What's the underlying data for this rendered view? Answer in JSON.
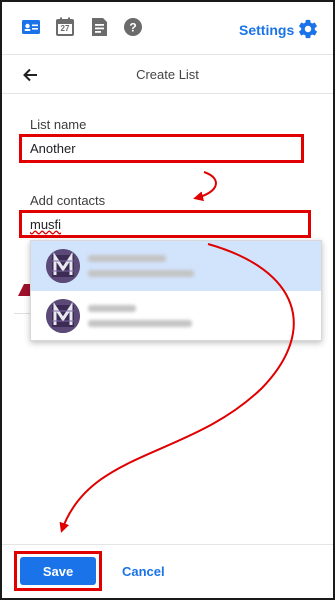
{
  "topbar": {
    "icons": [
      "contacts-icon",
      "calendar-icon",
      "tasks-icon",
      "help-icon"
    ],
    "calendar_day": "27",
    "settings_label": "Settings"
  },
  "header": {
    "title": "Create List"
  },
  "form": {
    "list_name_label": "List name",
    "list_name_value": "Another",
    "add_contacts_label": "Add contacts",
    "add_contacts_value": "musfi"
  },
  "suggestions": [
    {
      "initial": "M",
      "selected": true
    },
    {
      "initial": "M",
      "selected": false
    }
  ],
  "footer": {
    "save_label": "Save",
    "cancel_label": "Cancel"
  },
  "colors": {
    "accent": "#1a73e8",
    "annotation": "#e00000",
    "selected_row": "#d2e3fc"
  }
}
